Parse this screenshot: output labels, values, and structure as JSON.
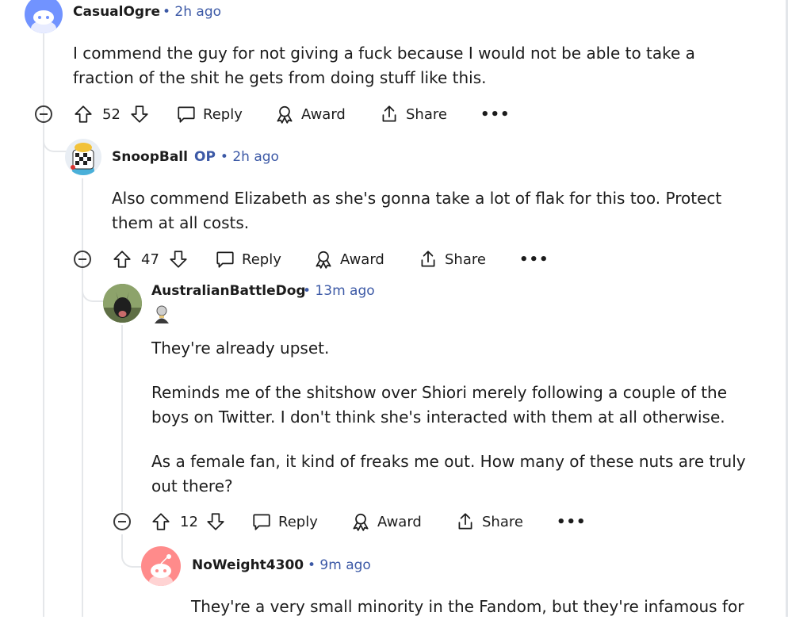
{
  "comments": [
    {
      "username": "CasualOgre",
      "time": "• 2h ago",
      "body": [
        "I commend the guy for not giving a fuck because I would not be able to take a fraction of the shit he gets from doing stuff like this."
      ],
      "votes": "52"
    },
    {
      "username": "SnoopBall",
      "op_badge": "OP",
      "time": "• 2h ago",
      "body": [
        "Also commend Elizabeth as she's gonna take a lot of flak for this too. Protect them at all costs."
      ],
      "votes": "47"
    },
    {
      "username": "AustralianBattleDog",
      "time": "• 13m ago",
      "body": [
        "They're already upset.",
        "Reminds me of the shitshow over Shiori merely following a couple of the boys on Twitter. I don't think she's interacted with them at all otherwise.",
        "As a female fan, it kind of freaks me out. How many of these nuts are truly out there?"
      ],
      "votes": "12"
    },
    {
      "username": "NoWeight4300",
      "time": "• 9m ago",
      "body": [
        "They're a very small minority in the Fandom, but they're infamous for"
      ]
    }
  ],
  "actions": {
    "reply": "Reply",
    "award": "Award",
    "share": "Share",
    "more": "•••"
  },
  "colors": {
    "meta": "#3c59a6",
    "thread_line": "#e5e7ea",
    "avatar_default_blue": "#7193ff",
    "avatar_default_red": "#ff8b8b"
  }
}
